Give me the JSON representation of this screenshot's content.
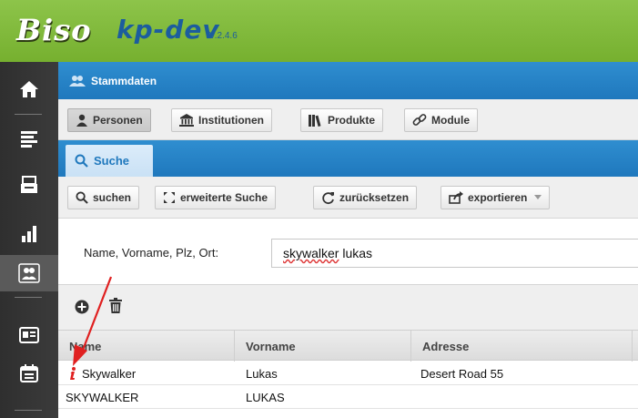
{
  "header": {
    "logo": "Biso",
    "app_name": "kp-dev",
    "version": "V.2.4.6"
  },
  "section": {
    "title": "Stammdaten"
  },
  "tabs": [
    {
      "label": "Personen"
    },
    {
      "label": "Institutionen"
    },
    {
      "label": "Produkte"
    },
    {
      "label": "Module"
    }
  ],
  "subtab": {
    "label": "Suche"
  },
  "actions": {
    "search": "suchen",
    "advanced": "erweiterte Suche",
    "reset": "zurücksetzen",
    "export": "exportieren"
  },
  "form": {
    "label": "Name, Vorname, Plz, Ort:",
    "value_word1": "skywalker",
    "value_word2": "lukas"
  },
  "table": {
    "columns": [
      "Name",
      "Vorname",
      "Adresse"
    ],
    "rows": [
      {
        "name": "Skywalker",
        "vorname": "Lukas",
        "adresse": "Desert Road 55"
      },
      {
        "name": "SKYWALKER",
        "vorname": "LUKAS",
        "adresse": ""
      }
    ]
  },
  "colors": {
    "accent_blue": "#1f78bd",
    "header_green": "#7ab534",
    "arrow_red": "#e02020"
  }
}
